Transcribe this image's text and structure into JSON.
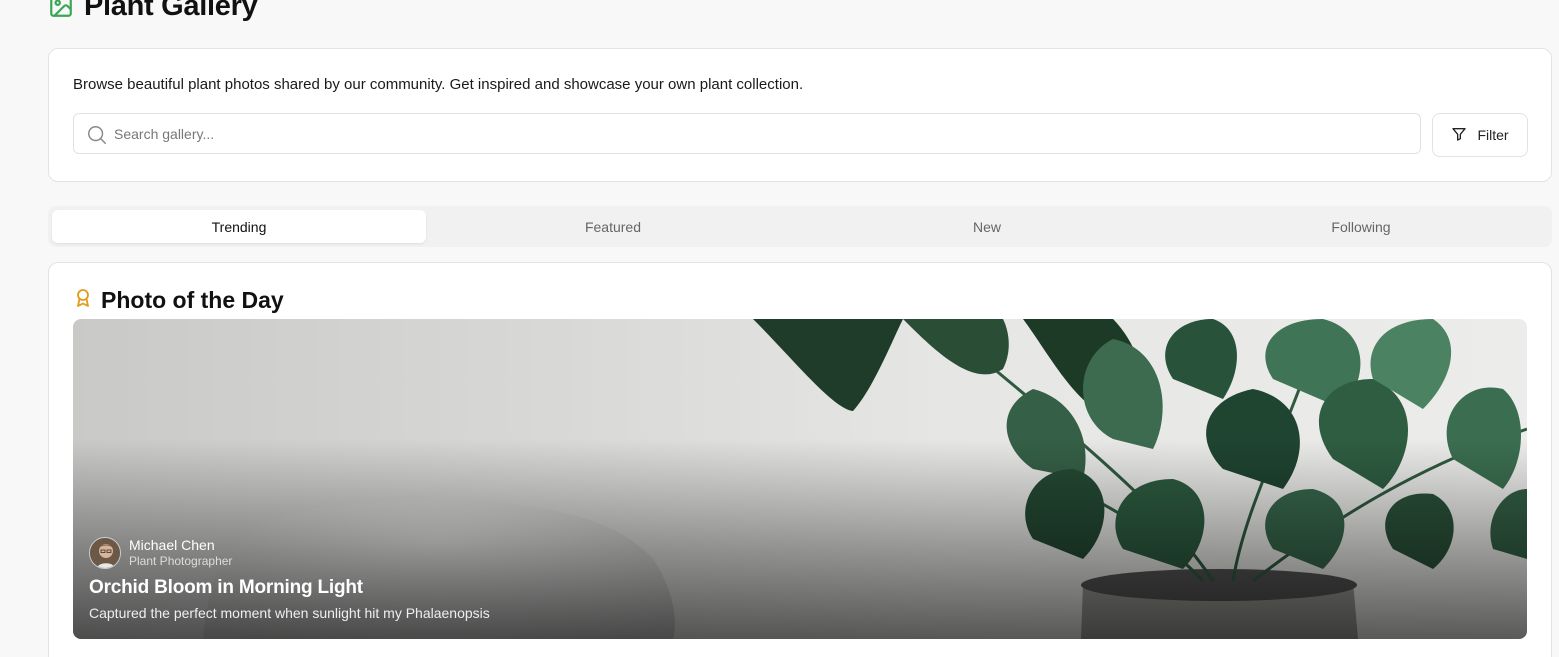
{
  "header": {
    "title": "Plant Gallery",
    "icon": "image-icon",
    "accent": "#3aa655"
  },
  "intro": {
    "text": "Browse beautiful plant photos shared by our community. Get inspired and showcase your own plant collection."
  },
  "search": {
    "placeholder": "Search gallery...",
    "value": "",
    "icon": "search-icon"
  },
  "filter": {
    "label": "Filter",
    "icon": "filter-icon"
  },
  "tabs": [
    {
      "label": "Trending",
      "active": true
    },
    {
      "label": "Featured",
      "active": false
    },
    {
      "label": "New",
      "active": false
    },
    {
      "label": "Following",
      "active": false
    }
  ],
  "photo_of_day": {
    "heading": "Photo of the Day",
    "icon": "award-icon",
    "icon_color": "#e39a16",
    "author": {
      "name": "Michael Chen",
      "role": "Plant Photographer"
    },
    "title": "Orchid Bloom in Morning Light",
    "caption": "Captured the perfect moment when sunlight hit my Phalaenopsis"
  }
}
